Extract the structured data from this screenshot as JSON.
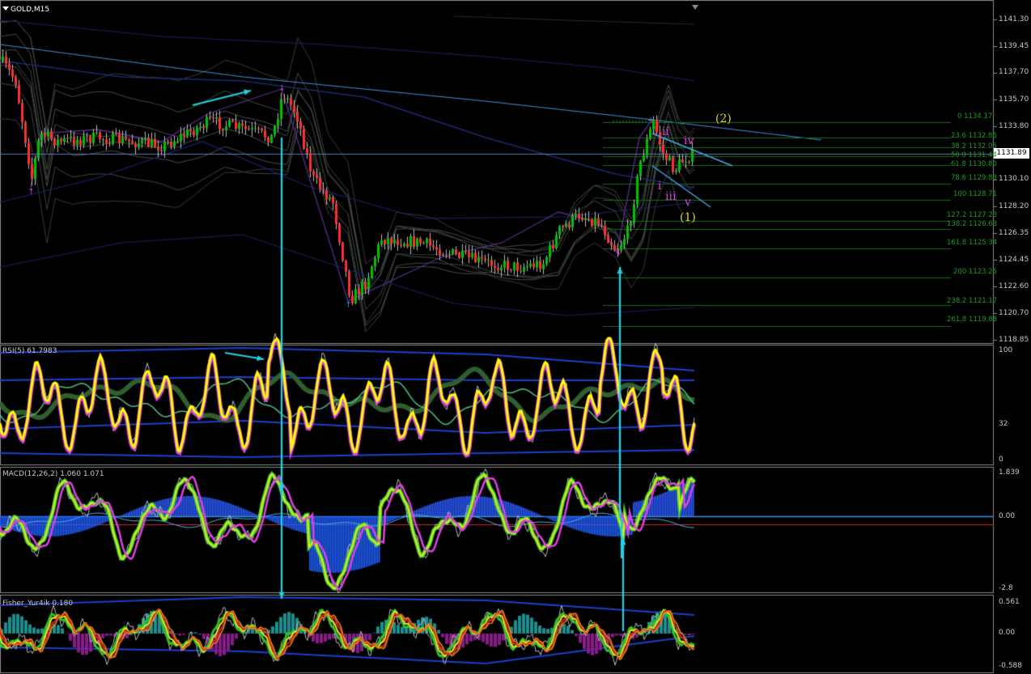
{
  "window": {
    "title": "GOLD,M15"
  },
  "main_panel": {
    "price_axis": [
      "1141.30",
      "1139.45",
      "1137.70",
      "1135.70",
      "1133.80",
      "1131.89",
      "1130.10",
      "1128.20",
      "1126.35",
      "1124.45",
      "1122.60",
      "1120.70",
      "1118.85"
    ],
    "current_price": "1131.89",
    "fib_levels": [
      {
        "label": "0 1134.17"
      },
      {
        "label": "23.6 1132.86"
      },
      {
        "label": "38.2 1132.05"
      },
      {
        "label": "50.0 1131.44"
      },
      {
        "label": "61.8 1130.80"
      },
      {
        "label": "78.6 1129.88"
      },
      {
        "label": "100 1128.71"
      },
      {
        "label": "127.2 1127.23"
      },
      {
        "label": "138.2 1126.63"
      },
      {
        "label": "161.8 1125.34"
      },
      {
        "label": "200 1123.25"
      },
      {
        "label": "238.2 1121.17"
      },
      {
        "label": "261.8 1119.88"
      }
    ],
    "wave_labels": {
      "ii": "ii",
      "iv": "iv",
      "i": "i",
      "iii": "iii",
      "v": "v",
      "wave1": "(1)",
      "wave2": "(2)"
    }
  },
  "rsi_panel": {
    "title": "RSI(5) 61.7983",
    "axis": [
      "100",
      "32",
      "0"
    ]
  },
  "macd_panel": {
    "title": "MACD(12,26,2) 1.060 1.071",
    "axis": [
      "1.839",
      "0.00",
      "-2.8"
    ]
  },
  "fisher_panel": {
    "title": "Fisher_Yur4ik 0.180",
    "axis": [
      "0.561",
      "0.00",
      "-0.588"
    ]
  },
  "colors": {
    "background": "#000000",
    "bull_candle": "#00c000",
    "bear_candle": "#ff3030",
    "rsi_line": "#ffff00",
    "macd_hist": "#1f5fff",
    "arrow": "#1fd3e6",
    "fib": "#1f9a1f"
  }
}
